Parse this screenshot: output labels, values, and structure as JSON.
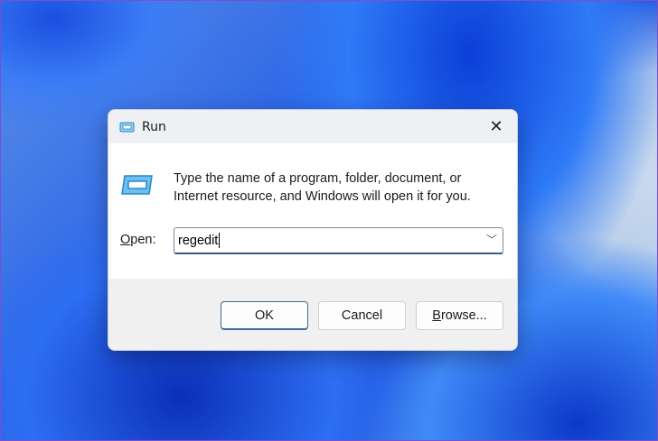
{
  "dialog": {
    "title": "Run",
    "description_line1": "Type the name of a program, folder, document, or",
    "description_line2": "Internet resource, and Windows will open it for you.",
    "open_label_mnemonic": "O",
    "open_label_rest": "pen:",
    "input_value": "regedit",
    "buttons": {
      "ok": "OK",
      "cancel": "Cancel",
      "browse_mnemonic": "B",
      "browse_rest": "rowse..."
    }
  }
}
